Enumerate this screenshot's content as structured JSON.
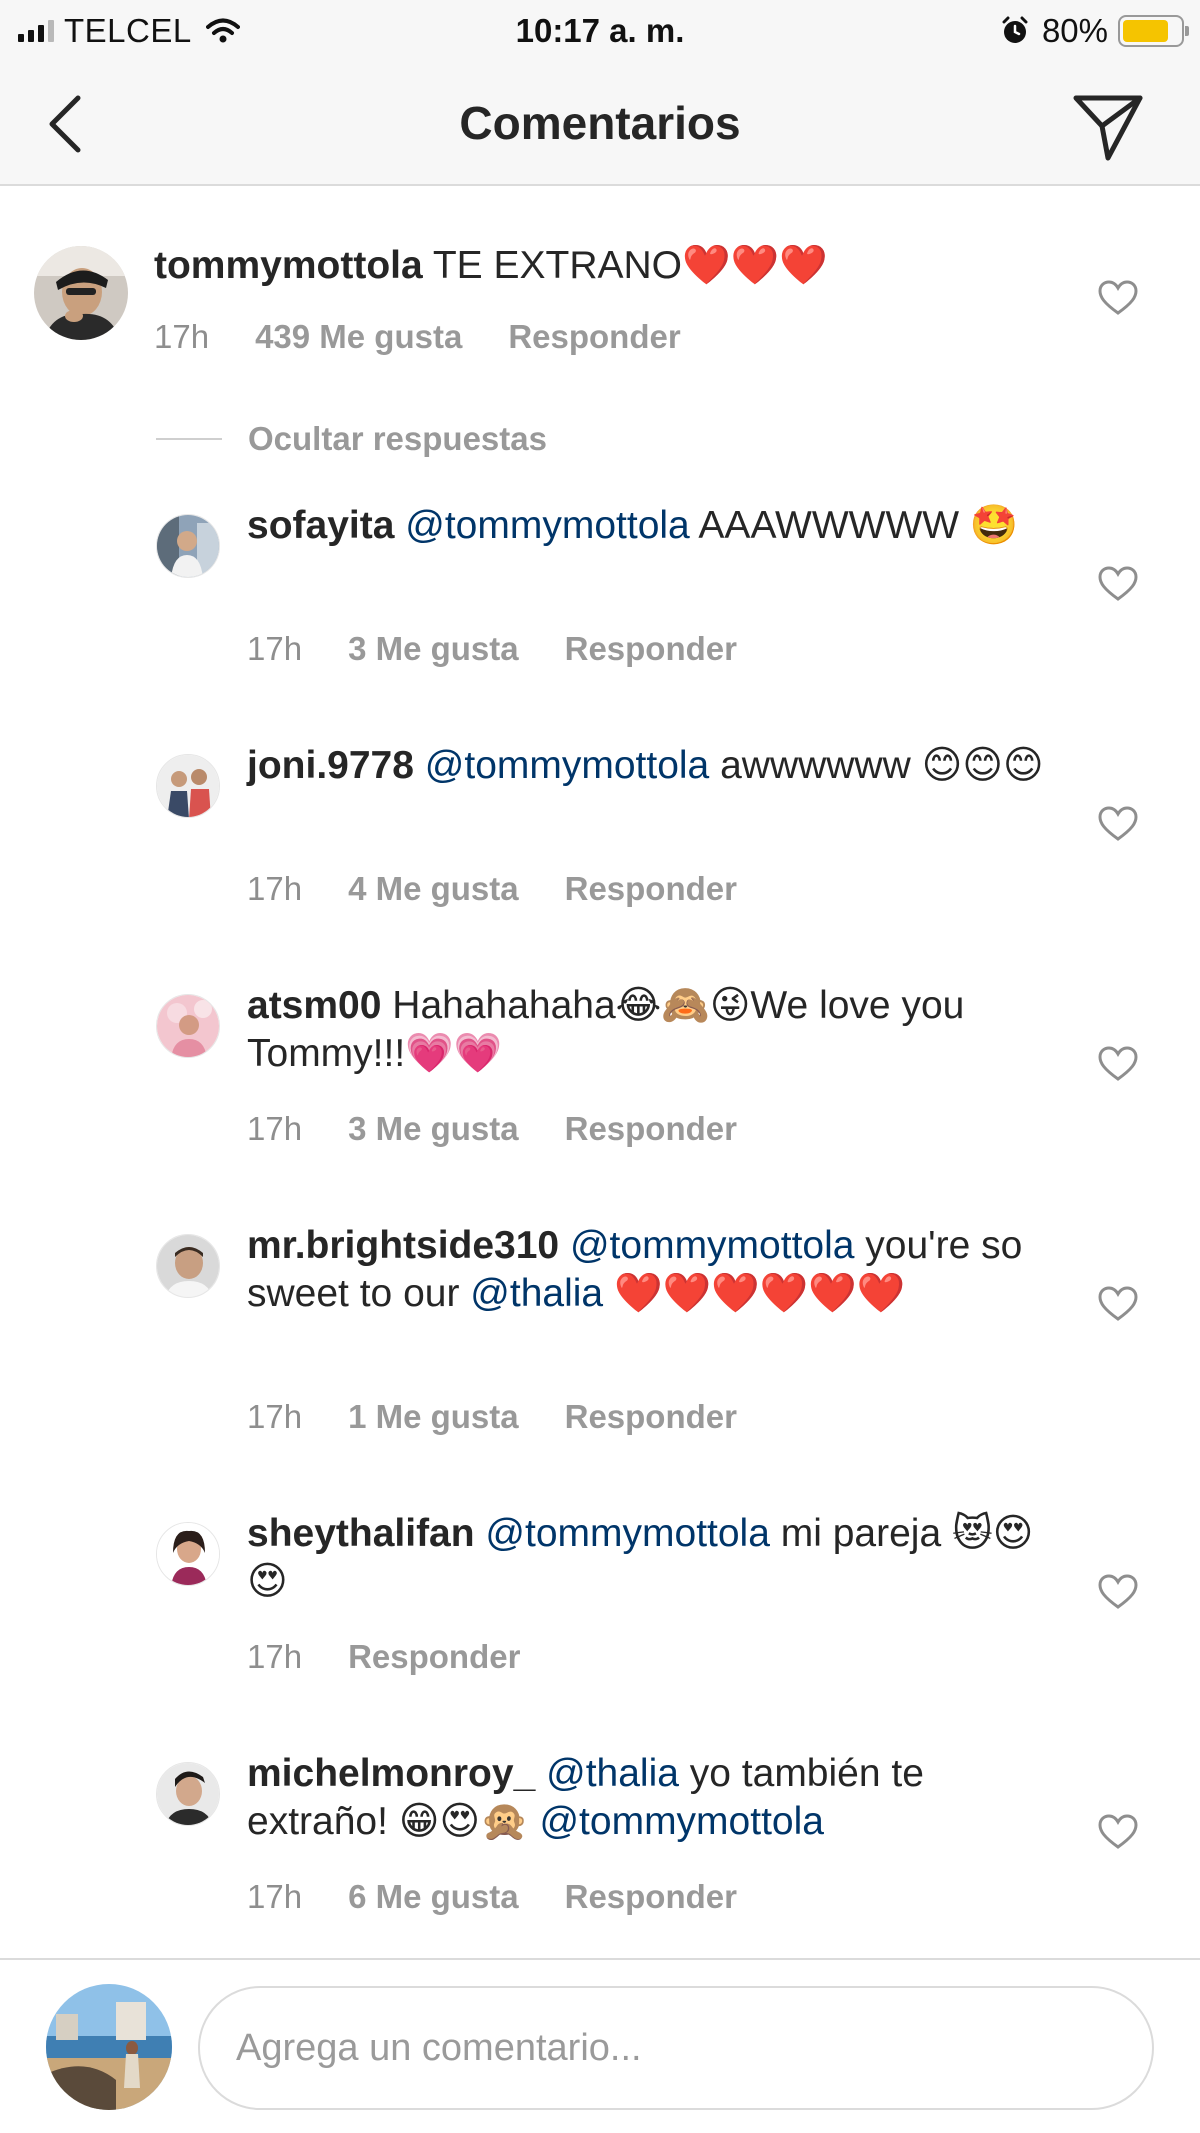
{
  "status_bar": {
    "carrier": "TELCEL",
    "time": "10:17 a. m.",
    "battery_percent": "80%",
    "battery_level": 0.8,
    "battery_color": "#f5c400"
  },
  "header": {
    "title": "Comentarios",
    "back_icon": "chevron-left-icon",
    "send_icon": "paper-plane-icon"
  },
  "main_comment": {
    "username": "tommymottola",
    "text": " TE EXTRANO❤️❤️❤️",
    "time": "17h",
    "likes": "439 Me gusta",
    "reply_label": "Responder"
  },
  "hide_replies_label": "Ocultar respuestas",
  "replies": [
    {
      "username": "sofayita",
      "parts": [
        {
          "t": " "
        },
        {
          "t": "@tommymottola",
          "m": true
        },
        {
          "t": " AAAWWWWW 🤩"
        }
      ],
      "time": "17h",
      "likes": "3 Me gusta",
      "reply_label": "Responder"
    },
    {
      "username": "joni.9778",
      "parts": [
        {
          "t": " "
        },
        {
          "t": "@tommymottola",
          "m": true
        },
        {
          "t": " awwwwww 😊😊😊"
        }
      ],
      "time": "17h",
      "likes": "4 Me gusta",
      "reply_label": "Responder"
    },
    {
      "username": "atsm00",
      "parts": [
        {
          "t": " Hahahahaha😂🙈😜We love you Tommy!!!💗💗"
        }
      ],
      "time": "17h",
      "likes": "3 Me gusta",
      "reply_label": "Responder"
    },
    {
      "username": "mr.brightside310",
      "parts": [
        {
          "t": " "
        },
        {
          "t": "@tommymottola",
          "m": true
        },
        {
          "t": " you're so sweet to our "
        },
        {
          "t": "@thalia",
          "m": true
        },
        {
          "t": " ❤️❤️❤️❤️❤️❤️"
        }
      ],
      "time": "17h",
      "likes": "1 Me gusta",
      "reply_label": "Responder"
    },
    {
      "username": "sheythalifan",
      "parts": [
        {
          "t": " "
        },
        {
          "t": "@tommymottola",
          "m": true
        },
        {
          "t": " mi pareja 😻😍😍"
        }
      ],
      "time": "17h",
      "likes": "",
      "reply_label": "Responder"
    },
    {
      "username": "michelmonroy_",
      "parts": [
        {
          "t": " "
        },
        {
          "t": "@thalia",
          "m": true
        },
        {
          "t": " yo también te extraño! 😁😍🙊 "
        },
        {
          "t": "@tommymottola",
          "m": true
        }
      ],
      "time": "17h",
      "likes": "6 Me gusta",
      "reply_label": "Responder"
    }
  ],
  "input": {
    "placeholder": "Agrega un comentario..."
  },
  "colors": {
    "mention": "#003569",
    "meta": "#8e8e8e",
    "divider": "#dbdbdb"
  }
}
